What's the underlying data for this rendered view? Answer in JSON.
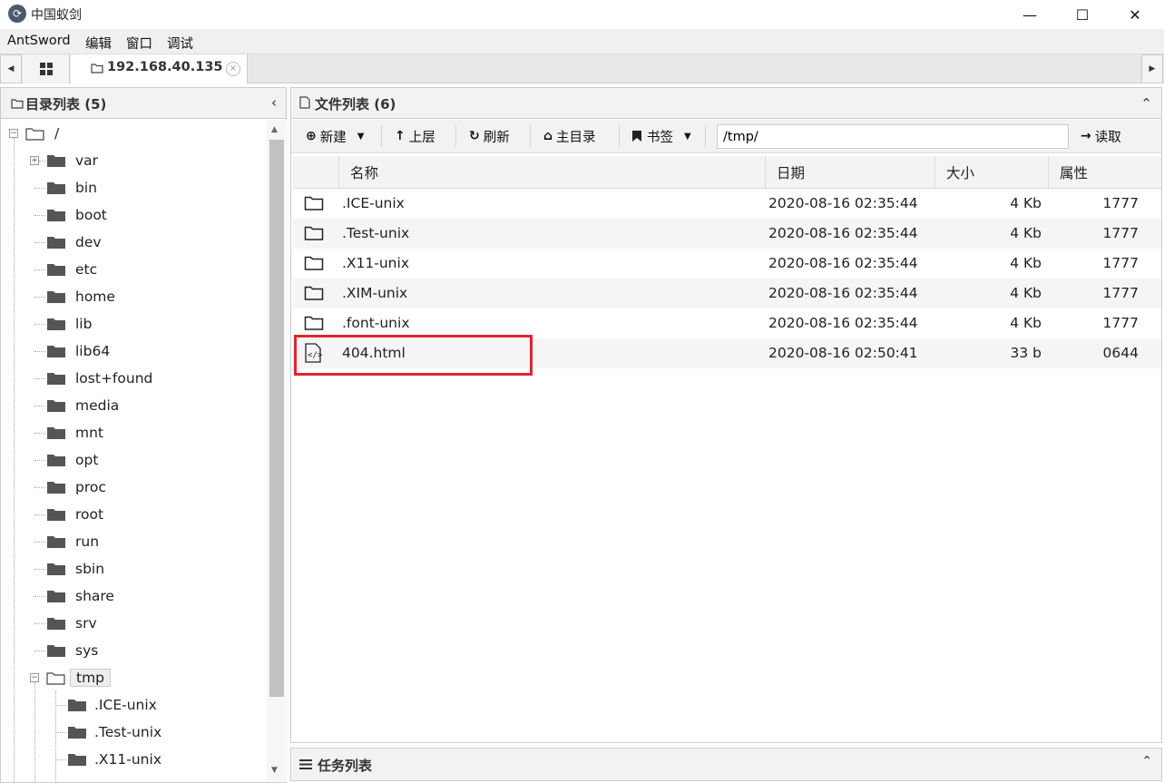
{
  "window": {
    "title": "中国蚁剑",
    "minimize": "—",
    "maximize": "☐",
    "close": "✕"
  },
  "menu": [
    "AntSword",
    "编辑",
    "窗口",
    "调试"
  ],
  "tabs": {
    "active_label": "192.168.40.135",
    "close_glyph": "×"
  },
  "left_panel": {
    "title": "目录列表 (5)",
    "collapse_glyph": "‹",
    "root": "/",
    "items": [
      "var",
      "bin",
      "boot",
      "dev",
      "etc",
      "home",
      "lib",
      "lib64",
      "lost+found",
      "media",
      "mnt",
      "opt",
      "proc",
      "root",
      "run",
      "sbin",
      "share",
      "srv",
      "sys"
    ],
    "expanded_item": "tmp",
    "sub_items": [
      ".ICE-unix",
      ".Test-unix",
      ".X11-unix"
    ]
  },
  "right_panel": {
    "title": "文件列表 (6)",
    "collapse_glyph": "⌃",
    "toolbar": {
      "new": "新建",
      "up": "上层",
      "refresh": "刷新",
      "home": "主目录",
      "bookmark": "书签",
      "path": "/tmp/",
      "read": "读取"
    },
    "columns": [
      "名称",
      "日期",
      "大小",
      "属性"
    ],
    "files": [
      {
        "name": ".ICE-unix",
        "date": "2020-08-16 02:35:44",
        "size": "4 Kb",
        "perm": "1777",
        "type": "folder"
      },
      {
        "name": ".Test-unix",
        "date": "2020-08-16 02:35:44",
        "size": "4 Kb",
        "perm": "1777",
        "type": "folder"
      },
      {
        "name": ".X11-unix",
        "date": "2020-08-16 02:35:44",
        "size": "4 Kb",
        "perm": "1777",
        "type": "folder"
      },
      {
        "name": ".XIM-unix",
        "date": "2020-08-16 02:35:44",
        "size": "4 Kb",
        "perm": "1777",
        "type": "folder"
      },
      {
        "name": ".font-unix",
        "date": "2020-08-16 02:35:44",
        "size": "4 Kb",
        "perm": "1777",
        "type": "folder"
      },
      {
        "name": "404.html",
        "date": "2020-08-16 02:50:41",
        "size": "33 b",
        "perm": "0644",
        "type": "code-file"
      }
    ]
  },
  "task_panel": {
    "title": "任务列表",
    "collapse_glyph": "⌃"
  },
  "colors": {
    "highlight": "#e0252b",
    "folder": "#555555"
  }
}
